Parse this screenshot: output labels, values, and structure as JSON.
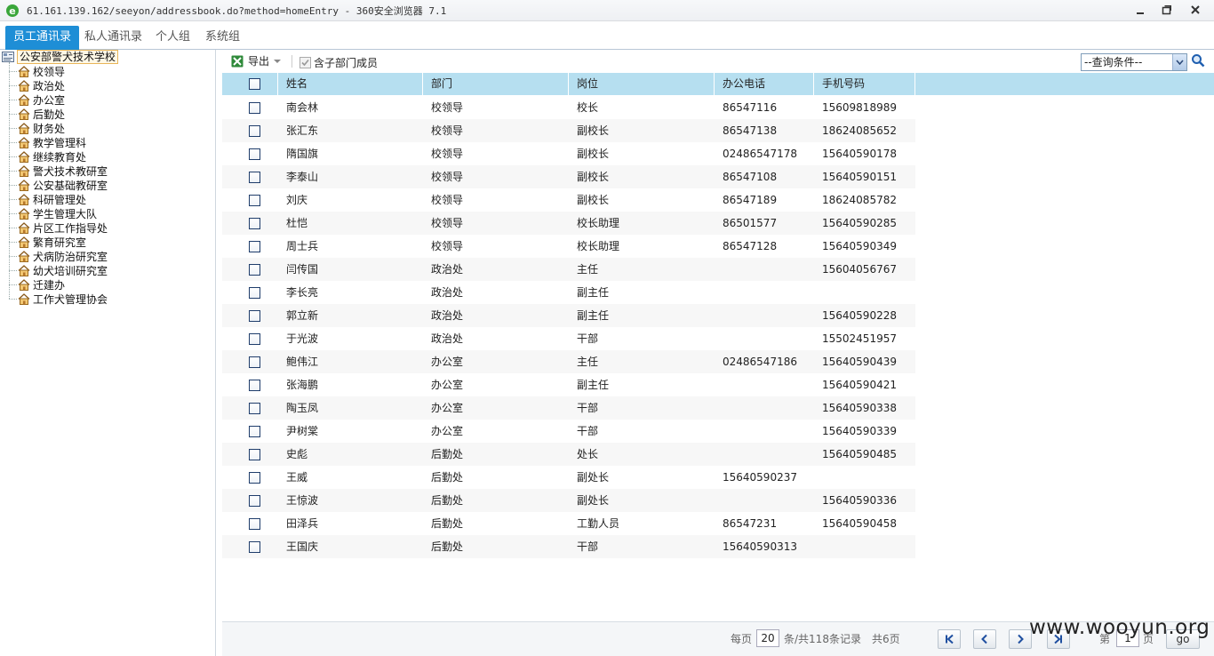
{
  "window": {
    "title": "61.161.139.162/seeyon/addressbook.do?method=homeEntry - 360安全浏览器 7.1"
  },
  "tabs": [
    {
      "label": "员工通讯录",
      "active": true
    },
    {
      "label": "私人通讯录",
      "active": false
    },
    {
      "label": "个人组",
      "active": false
    },
    {
      "label": "系统组",
      "active": false
    }
  ],
  "tree": {
    "root": "公安部警犬技术学校",
    "items": [
      "校领导",
      "政治处",
      "办公室",
      "后勤处",
      "财务处",
      "教学管理科",
      "继续教育处",
      "警犬技术教研室",
      "公安基础教研室",
      "科研管理处",
      "学生管理大队",
      "片区工作指导处",
      "繁育研究室",
      "犬病防治研究室",
      "幼犬培训研究室",
      "迁建办",
      "工作犬管理协会"
    ]
  },
  "toolbar": {
    "export_label": "导出",
    "include_sub_label": "含子部门成员",
    "include_sub_checked": true,
    "query_select_value": "--查询条件--"
  },
  "table": {
    "headers": {
      "name": "姓名",
      "dept": "部门",
      "position": "岗位",
      "office_phone": "办公电话",
      "mobile": "手机号码"
    },
    "rows": [
      {
        "name": "南会林",
        "dept": "校领导",
        "position": "校长",
        "office_phone": "86547116",
        "mobile": "15609818989"
      },
      {
        "name": "张汇东",
        "dept": "校领导",
        "position": "副校长",
        "office_phone": "86547138",
        "mobile": "18624085652"
      },
      {
        "name": "隋国旗",
        "dept": "校领导",
        "position": "副校长",
        "office_phone": "02486547178",
        "mobile": "15640590178"
      },
      {
        "name": "李泰山",
        "dept": "校领导",
        "position": "副校长",
        "office_phone": "86547108",
        "mobile": "15640590151"
      },
      {
        "name": "刘庆",
        "dept": "校领导",
        "position": "副校长",
        "office_phone": "86547189",
        "mobile": "18624085782"
      },
      {
        "name": "杜恺",
        "dept": "校领导",
        "position": "校长助理",
        "office_phone": "86501577",
        "mobile": "15640590285"
      },
      {
        "name": "周士兵",
        "dept": "校领导",
        "position": "校长助理",
        "office_phone": "86547128",
        "mobile": "15640590349"
      },
      {
        "name": "闫传国",
        "dept": "政治处",
        "position": "主任",
        "office_phone": "",
        "mobile": "15604056767"
      },
      {
        "name": "李长亮",
        "dept": "政治处",
        "position": "副主任",
        "office_phone": "",
        "mobile": ""
      },
      {
        "name": "郭立新",
        "dept": "政治处",
        "position": "副主任",
        "office_phone": "",
        "mobile": "15640590228"
      },
      {
        "name": "于光波",
        "dept": "政治处",
        "position": "干部",
        "office_phone": "",
        "mobile": "15502451957"
      },
      {
        "name": "鲍伟江",
        "dept": "办公室",
        "position": "主任",
        "office_phone": "02486547186",
        "mobile": "15640590439"
      },
      {
        "name": "张海鹏",
        "dept": "办公室",
        "position": "副主任",
        "office_phone": "",
        "mobile": "15640590421"
      },
      {
        "name": "陶玉凤",
        "dept": "办公室",
        "position": "干部",
        "office_phone": "",
        "mobile": "15640590338"
      },
      {
        "name": "尹树棠",
        "dept": "办公室",
        "position": "干部",
        "office_phone": "",
        "mobile": "15640590339"
      },
      {
        "name": "史彪",
        "dept": "后勤处",
        "position": "处长",
        "office_phone": "",
        "mobile": "15640590485"
      },
      {
        "name": "王威",
        "dept": "后勤处",
        "position": "副处长",
        "office_phone": "15640590237",
        "mobile": ""
      },
      {
        "name": "王惊波",
        "dept": "后勤处",
        "position": "副处长",
        "office_phone": "",
        "mobile": "15640590336"
      },
      {
        "name": "田泽兵",
        "dept": "后勤处",
        "position": "工勤人员",
        "office_phone": "86547231",
        "mobile": "15640590458"
      },
      {
        "name": "王国庆",
        "dept": "后勤处",
        "position": "干部",
        "office_phone": "15640590313",
        "mobile": ""
      }
    ]
  },
  "pager": {
    "per_page_prefix": "每页",
    "per_page_value": "20",
    "total_text": "条/共118条记录",
    "pages_text": "共6页",
    "page_prefix": "第",
    "page_value": "1",
    "page_suffix": "页",
    "go_label": "go"
  },
  "watermark": "www.wooyun.org",
  "colors": {
    "tab_active": "#1e8ed6",
    "table_header": "#b6dff0",
    "pager_icon": "#1f4fa0"
  }
}
